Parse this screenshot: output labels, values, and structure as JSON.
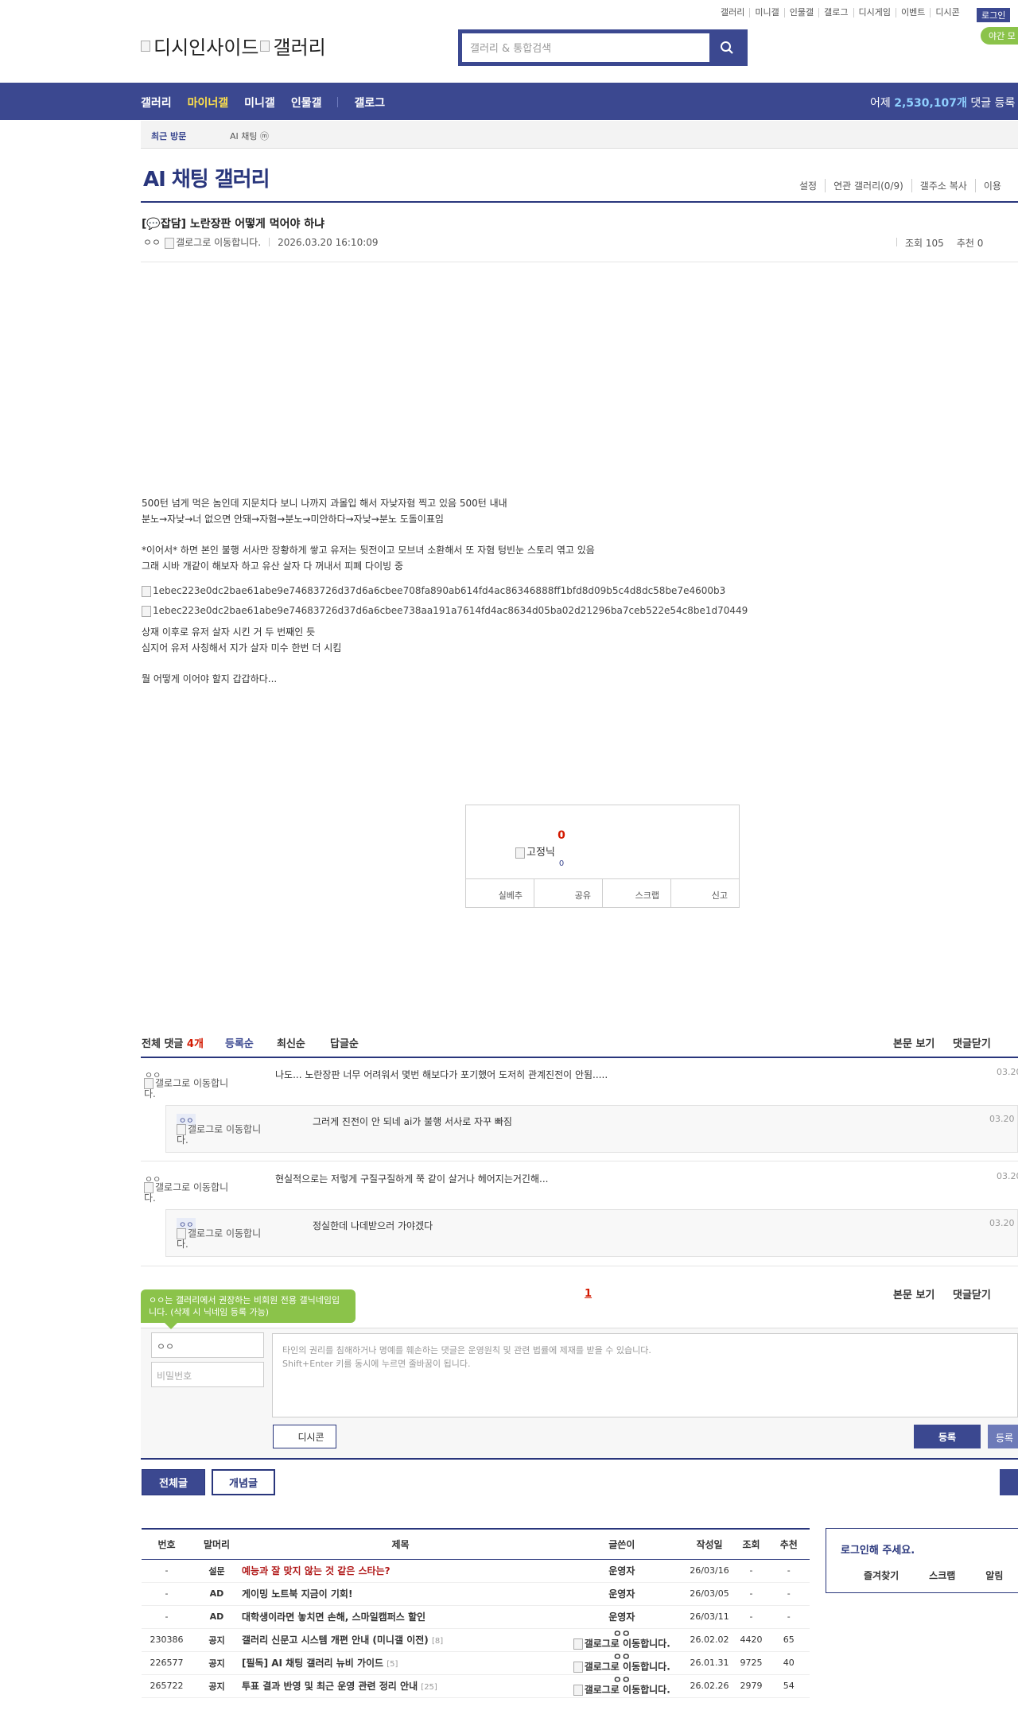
{
  "top_menu": [
    "갤러리",
    "미니갤",
    "인물갤",
    "갤로그",
    "디시게임",
    "이벤트",
    "디시콘"
  ],
  "login_label": "로그인",
  "night_mode_label": "야간 모",
  "logo": {
    "left_alt": "디시인사이드",
    "right_alt": "갤러리"
  },
  "search": {
    "placeholder": "갤러리 & 통합검색"
  },
  "nav": {
    "items": [
      "갤러리",
      "마이너갤",
      "미니갤",
      "인물갤",
      "갤로그"
    ],
    "stat_prefix": "어제",
    "stat_num": "2,530,107개",
    "stat_suffix": "댓글 등록"
  },
  "subbar": {
    "recent": "최근 방문",
    "tag": "AI 채팅 ⓜ"
  },
  "gallery": {
    "title": "AI 채팅 갤러리",
    "tools": [
      "설정",
      "연관 갤러리(0/9)",
      "갤주소 복사",
      "이용"
    ]
  },
  "post": {
    "title": "[💬잡담] 노란장판 어떻게 먹어야 하냐",
    "author": "ㅇㅇ",
    "author_img_alt": "갤로그로 이동합니다.",
    "date": "2026.03.20 16:10:09",
    "views": "조회 105",
    "recommends": "추천 0",
    "body": [
      "500턴 넘게 먹은 놈인데 지문치다 보니 나까지 과몰입 해서 자낮자혐 찍고 있음 500턴 내내",
      "분노→자낮→너 없으면 안돼→자혐→분노→미안하다→자낮→분노 도돌이표임",
      "*이어서* 하면 본인 불행 서사만 장황하게 쌓고 유저는 뒷전이고 모브녀 소환해서 또 자혐 텅빈눈 스토리 엮고 있음",
      "그래 시바 개같이 해보자 하고 유산 살자 다 꺼내서 피폐 다이빙 중",
      "1ebec223e0dc2bae61abe9e74683726d37d6a6cbee708fa890ab614fd4ac86346888ff1bfd8d09b5c4d8dc58be7e4600b3",
      "1ebec223e0dc2bae61abe9e74683726d37d6a6cbee738aa191a7614fd4ac8634d05ba02d21296ba7ceb522e54c8be1d70449",
      "상재 이후로 유저 살자 시킨 거 두 번째인 듯",
      "심지어 유저 사칭해서 지가 살자 미수 한번 더 시킴",
      "뭘 어떻게 이어야 할지 갑갑하다..."
    ]
  },
  "recommend": {
    "up_count": "0",
    "fixed_alt": "고정닉",
    "fixed_count": "0",
    "buttons": [
      "실베추",
      "공유",
      "스크랩",
      "신고"
    ]
  },
  "comments": {
    "total_label": "전체 댓글",
    "total_count": "4개",
    "tabs": [
      "등록순",
      "최신순",
      "답글순"
    ],
    "right_tools": [
      "본문 보기",
      "댓글닫기"
    ],
    "items": [
      {
        "name": "ㅇㅇ",
        "img_alt": "갤로그로 이동합니다.",
        "text": "나도... 노란장판 너무 어려워서 몇번 해보다가 포기했어 도저히 관계진전이 안됨.....",
        "date": "03.20"
      },
      {
        "name": "ㅇㅇ",
        "img_alt": "갤로그로 이동합니다.",
        "text": "그러게 진전이 안 되네 ai가 불행 서사로 자꾸 빠짐",
        "date": "03.20 1"
      },
      {
        "name": "ㅇㅇ",
        "img_alt": "갤로그로 이동합니다.",
        "text": "현실적으로는 저렇게 구질구질하게 쭉 같이 살거나 헤어지는거긴해...",
        "date": "03.20"
      },
      {
        "name": "ㅇㅇ",
        "img_alt": "갤로그로 이동합니다.",
        "text": "정실한데 나데받으러 가야겠다",
        "date": "03.20 1"
      }
    ],
    "page": "1"
  },
  "write": {
    "tooltip": "ㅇㅇ는 갤러리에서 권장하는 비회원 전용 갤닉네임입니다. (삭제 시 닉네임 등록 가능)",
    "nick_value": "ㅇㅇ",
    "password_placeholder": "비밀번호",
    "textarea_line1": "타인의 권리를 침해하거나 명예를 훼손하는 댓글은 운영원칙 및 관련 법률에 제재를 받을 수 있습니다.",
    "textarea_line2": "Shift+Enter 키를 동시에 누르면 줄바꿈이 됩니다.",
    "dccon_label": "디시콘",
    "submit_label": "등록",
    "submit2_label": "등록"
  },
  "list_buttons": {
    "all": "전체글",
    "concept": "개념글"
  },
  "table": {
    "headers": [
      "번호",
      "말머리",
      "제목",
      "글쓴이",
      "작성일",
      "조회",
      "추천"
    ],
    "rows": [
      {
        "no": "-",
        "head": "설문",
        "subject": "예능과 잘 맞지 않는 것 같은 스타는?",
        "replies": "",
        "writer": "운영자",
        "writer_top": "",
        "date": "26/03/16",
        "views": "-",
        "rec": "-",
        "red": true
      },
      {
        "no": "-",
        "head": "AD",
        "subject": "게이밍 노트북 지금이 기회!",
        "replies": "",
        "writer": "운영자",
        "writer_top": "",
        "date": "26/03/05",
        "views": "-",
        "rec": "-",
        "red": false
      },
      {
        "no": "-",
        "head": "AD",
        "subject": "대학생이라면 놓치면 손해, 스마일캠퍼스 할인",
        "replies": "",
        "writer": "운영자",
        "writer_top": "",
        "date": "26/03/11",
        "views": "-",
        "rec": "-",
        "red": false
      },
      {
        "no": "230386",
        "head": "공지",
        "subject": "갤러리 신문고 시스템 개편 안내 (미니갤 이전)",
        "replies": "[8]",
        "writer": "갤로그로 이동합니다.",
        "writer_top": "ㅇㅇ",
        "date": "26.02.02",
        "views": "4420",
        "rec": "65",
        "red": false
      },
      {
        "no": "226577",
        "head": "공지",
        "subject": "[필독] AI 채팅 갤러리 뉴비 가이드",
        "replies": "[5]",
        "writer": "갤로그로 이동합니다.",
        "writer_top": "ㅇㅇ",
        "date": "26.01.31",
        "views": "9725",
        "rec": "40",
        "red": false
      },
      {
        "no": "265722",
        "head": "공지",
        "subject": "투표 결과 반영 및 최근 운영 관련 정리 안내",
        "replies": "[25]",
        "writer": "갤로그로 이동합니다.",
        "writer_top": "ㅇㅇ",
        "date": "26.02.26",
        "views": "2979",
        "rec": "54",
        "red": false
      }
    ]
  },
  "side": {
    "title": "로그인해 주세요.",
    "links": [
      "즐겨찾기",
      "스크랩",
      "알림"
    ]
  }
}
